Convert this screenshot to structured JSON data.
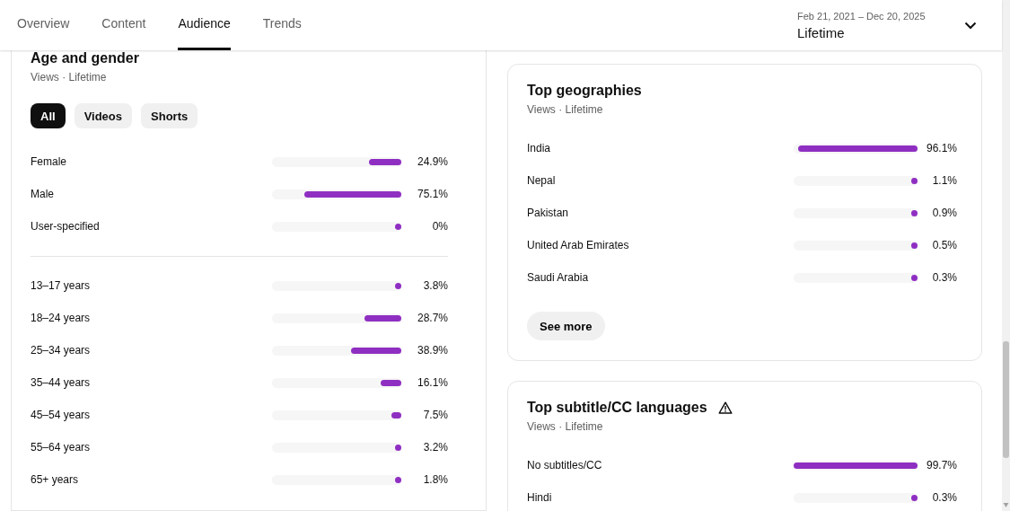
{
  "header": {
    "tabs": [
      {
        "label": "Overview",
        "selected": false
      },
      {
        "label": "Content",
        "selected": false
      },
      {
        "label": "Audience",
        "selected": true
      },
      {
        "label": "Trends",
        "selected": false
      }
    ],
    "date_range": {
      "range": "Feb 21, 2021 – Dec 20, 2025",
      "period": "Lifetime"
    }
  },
  "age_and_gender": {
    "title": "Age and gender",
    "subtitle": "Views · Lifetime",
    "filters": [
      {
        "label": "All",
        "selected": true
      },
      {
        "label": "Videos",
        "selected": false
      },
      {
        "label": "Shorts",
        "selected": false
      }
    ],
    "gender": [
      {
        "label": "Female",
        "value": "24.9%",
        "level": 0.249
      },
      {
        "label": "Male",
        "value": "75.1%",
        "level": 0.751
      },
      {
        "label": "User-specified",
        "value": "0%",
        "level": 0
      }
    ],
    "age": [
      {
        "label": "13–17 years",
        "value": "3.8%",
        "level": 0.038
      },
      {
        "label": "18–24 years",
        "value": "28.7%",
        "level": 0.287
      },
      {
        "label": "25–34 years",
        "value": "38.9%",
        "level": 0.389
      },
      {
        "label": "35–44 years",
        "value": "16.1%",
        "level": 0.161
      },
      {
        "label": "45–54 years",
        "value": "7.5%",
        "level": 0.075
      },
      {
        "label": "55–64 years",
        "value": "3.2%",
        "level": 0.032
      },
      {
        "label": "65+ years",
        "value": "1.8%",
        "level": 0.018
      }
    ]
  },
  "top_geographies": {
    "title": "Top geographies",
    "subtitle": "Views · Lifetime",
    "rows": [
      {
        "label": "India",
        "value": "96.1%",
        "level": 0.961
      },
      {
        "label": "Nepal",
        "value": "1.1%",
        "level": 0.011
      },
      {
        "label": "Pakistan",
        "value": "0.9%",
        "level": 0.009
      },
      {
        "label": "United Arab Emirates",
        "value": "0.5%",
        "level": 0.005
      },
      {
        "label": "Saudi Arabia",
        "value": "0.3%",
        "level": 0.003
      }
    ],
    "button": "See more"
  },
  "top_subtitle_languages": {
    "title": "Top subtitle/CC languages",
    "subtitle": "Views · Lifetime",
    "rows": [
      {
        "label": "No subtitles/CC",
        "value": "99.7%",
        "level": 0.997
      },
      {
        "label": "Hindi",
        "value": "0.3%",
        "level": 0.003
      }
    ]
  }
}
